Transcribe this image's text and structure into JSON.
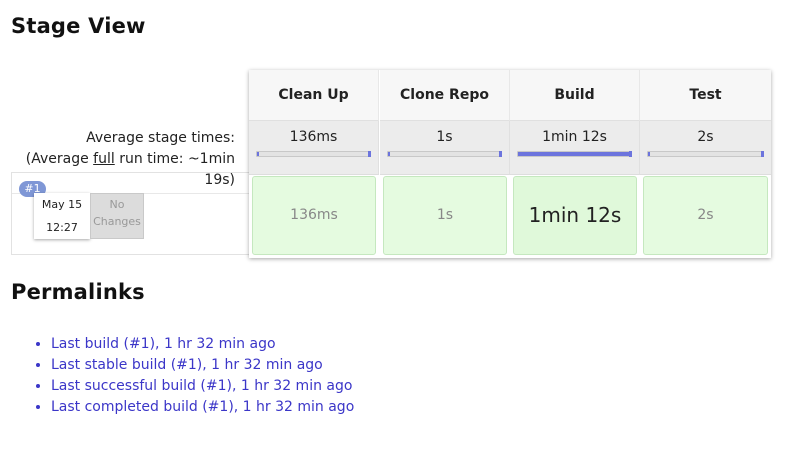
{
  "headings": {
    "stage_view": "Stage View",
    "permalinks": "Permalinks"
  },
  "avg_times": {
    "label": "Average stage times:",
    "line2_pre": "(Average ",
    "line2_link": "full",
    "line2_post": " run time: ~1min",
    "line3": "19s)"
  },
  "build": {
    "badge": "#1",
    "date": "May 15",
    "time": "12:27",
    "changes": "No Changes"
  },
  "stages": [
    {
      "name": "Clean Up",
      "avg": "136ms",
      "avg_fraction": 0.02,
      "run": "136ms"
    },
    {
      "name": "Clone Repo",
      "avg": "1s",
      "avg_fraction": 0.02,
      "run": "1s"
    },
    {
      "name": "Build",
      "avg": "1min 12s",
      "avg_fraction": 1.0,
      "run": "1min 12s"
    },
    {
      "name": "Test",
      "avg": "2s",
      "avg_fraction": 0.02,
      "run": "2s"
    }
  ],
  "colors": {
    "progress": "#6c74dd",
    "success_cell": "#e5fbe0",
    "link": "#3b36c8",
    "badge": "#7f97d6"
  },
  "permalinks": [
    "Last build (#1), 1 hr 32 min ago",
    "Last stable build (#1), 1 hr 32 min ago",
    "Last successful build (#1), 1 hr 32 min ago",
    "Last completed build (#1), 1 hr 32 min ago"
  ]
}
